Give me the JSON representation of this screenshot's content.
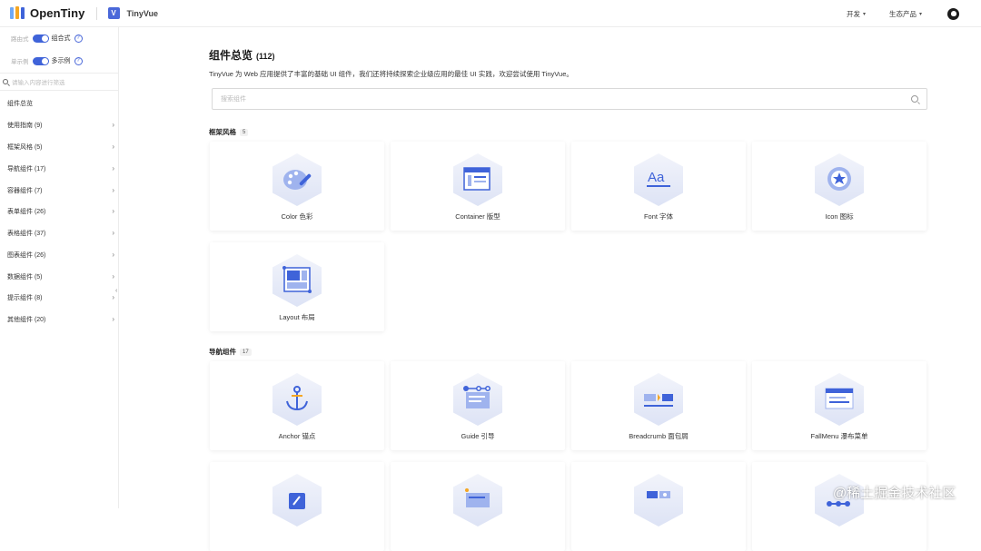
{
  "header": {
    "logo_text": "OpenTiny",
    "product_name": "TinyVue",
    "vue_badge": "V",
    "menus": [
      {
        "label": "开发"
      },
      {
        "label": "生态产品"
      }
    ],
    "github_icon": "github-icon"
  },
  "sidebar": {
    "toggles": [
      {
        "off_label": "路由式",
        "on_label": "组合式"
      },
      {
        "off_label": "单示例",
        "on_label": "多示例"
      }
    ],
    "search_placeholder": "请输入内容进行筛选",
    "items": [
      {
        "label": "组件总览",
        "has_children": false
      },
      {
        "label": "使用指南 (9)",
        "has_children": true
      },
      {
        "label": "框架风格 (5)",
        "has_children": true
      },
      {
        "label": "导航组件 (17)",
        "has_children": true
      },
      {
        "label": "容器组件 (7)",
        "has_children": true
      },
      {
        "label": "表单组件 (26)",
        "has_children": true
      },
      {
        "label": "表格组件 (37)",
        "has_children": true
      },
      {
        "label": "图表组件 (26)",
        "has_children": true
      },
      {
        "label": "数据组件 (5)",
        "has_children": true
      },
      {
        "label": "提示组件 (8)",
        "has_children": true
      },
      {
        "label": "其他组件 (20)",
        "has_children": true
      }
    ]
  },
  "main": {
    "title": "组件总览",
    "title_count": "(112)",
    "description": "TinyVue 为 Web 应用提供了丰富的基础 UI 组件，我们还将持续探索企业级应用的最佳 UI 实践，欢迎尝试使用 TinyVue。",
    "search_placeholder": "搜索组件",
    "sections": [
      {
        "name": "框架风格",
        "count": "5",
        "cards": [
          {
            "label": "Color 色彩",
            "icon": "palette-icon"
          },
          {
            "label": "Container 版型",
            "icon": "container-layout-icon"
          },
          {
            "label": "Font 字体",
            "icon": "font-icon"
          },
          {
            "label": "Icon 图标",
            "icon": "star-badge-icon"
          },
          {
            "label": "Layout 布局",
            "icon": "layout-grid-icon"
          }
        ]
      },
      {
        "name": "导航组件",
        "count": "17",
        "cards": [
          {
            "label": "Anchor 锚点",
            "icon": "anchor-icon"
          },
          {
            "label": "Guide 引导",
            "icon": "guide-icon"
          },
          {
            "label": "Breadcrumb 面包屑",
            "icon": "breadcrumb-icon"
          },
          {
            "label": "FallMenu 瀑布菜单",
            "icon": "fall-menu-icon"
          },
          {
            "label": "",
            "icon": "pin-icon"
          },
          {
            "label": "",
            "icon": "steps-icon"
          },
          {
            "label": "",
            "icon": "tabs-icon"
          },
          {
            "label": "",
            "icon": "tree-menu-icon"
          }
        ]
      }
    ]
  },
  "watermark": "@稀土掘金技术社区",
  "colors": {
    "accent": "#3f63d9",
    "text": "#333333",
    "border": "#ececec"
  }
}
